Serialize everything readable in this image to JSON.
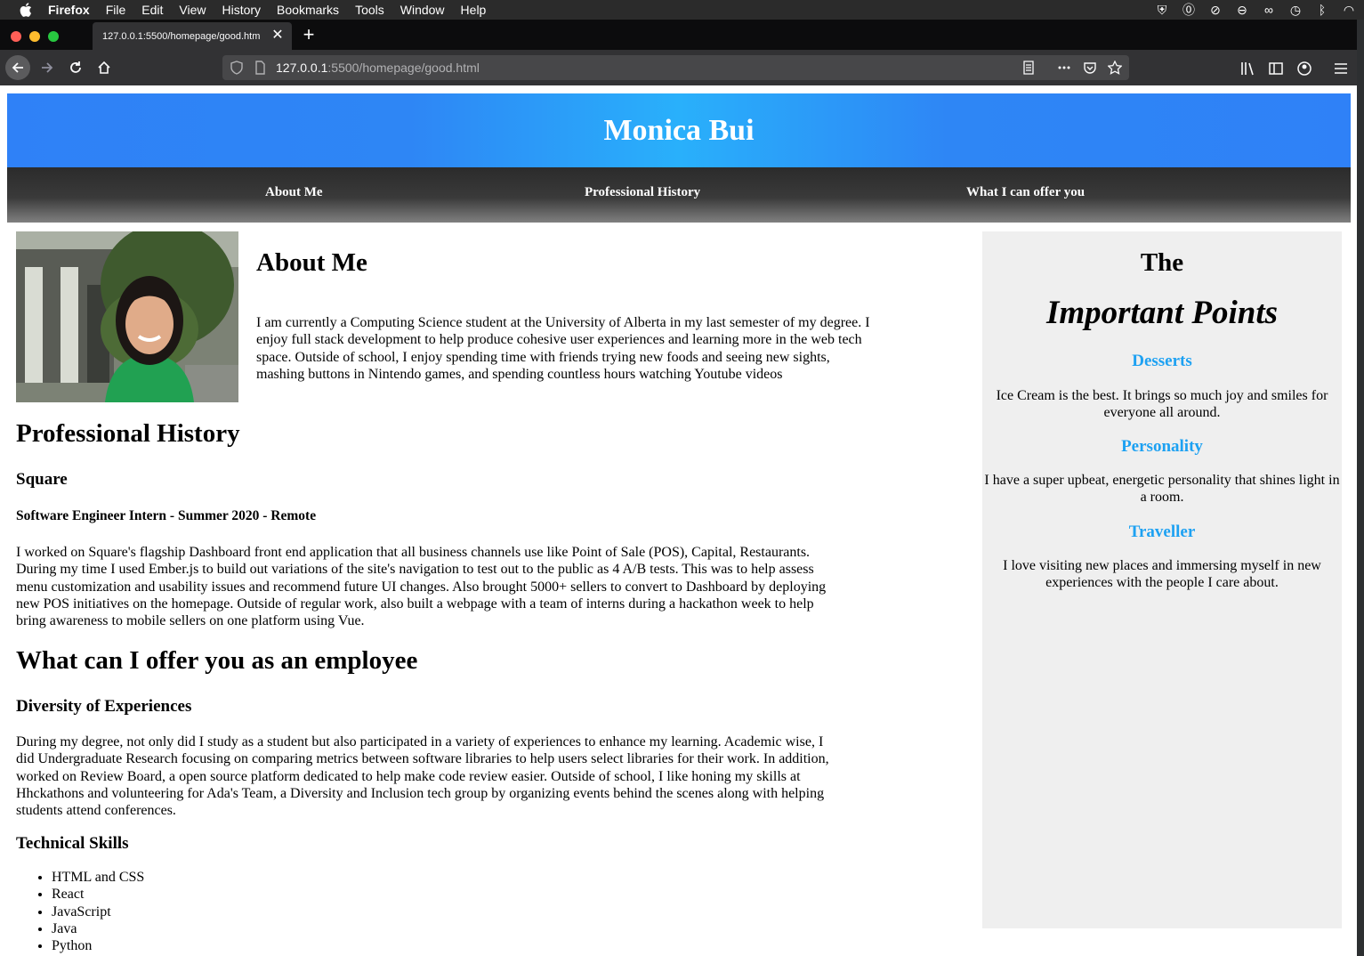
{
  "menubar": {
    "app": "Firefox",
    "items": [
      "File",
      "Edit",
      "View",
      "History",
      "Bookmarks",
      "Tools",
      "Window",
      "Help"
    ]
  },
  "browser": {
    "tab_title": "127.0.0.1:5500/homepage/good.htm",
    "url_host": "127.0.0.1",
    "url_rest": ":5500/homepage/good.html"
  },
  "site": {
    "name": "Monica Bui",
    "nav": [
      "About Me",
      "Professional History",
      "What I can offer you"
    ],
    "about": {
      "heading": "About Me",
      "text": "I am currently a Computing Science student at the University of Alberta in my last semester of my degree. I enjoy full stack development to help produce cohesive user experiences and learning more in the web tech space. Outside of school, I enjoy spending time with friends trying new foods and seeing new sights, mashing buttons in Nintendo games, and spending countless hours watching Youtube videos"
    },
    "history": {
      "heading": "Professional History",
      "company": "Square",
      "role": "Software Engineer Intern - Summer 2020 - Remote",
      "text": "I worked on Square's flagship Dashboard front end application that all business channels use like Point of Sale (POS), Capital, Restaurants. During my time I used Ember.js to build out variations of the site's navigation to test out to the public as 4 A/B tests. This was to help assess menu customization and usability issues and recommend future UI changes. Also brought 5000+ sellers to convert to Dashboard by deploying new POS initiatives on the homepage. Outside of regular work, also built a webpage with a team of interns during a hackathon week to help bring awareness to mobile sellers on one platform using Vue."
    },
    "offer": {
      "heading": "What can I offer you as an employee",
      "diversity_heading": "Diversity of Experiences",
      "diversity_text": "During my degree, not only did I study as a student but also participated in a variety of experiences to enhance my learning. Academic wise, I did Undergraduate Research focusing on comparing metrics between software libraries to help users select libraries for their work. In addition, worked on Review Board, a open source platform dedicated to help make code review easier. Outside of school, I like honing my skills at Hhckathons and volunteering for Ada's Team, a Diversity and Inclusion tech group by organizing events behind the scenes along with helping students attend conferences.",
      "skills_heading": "Technical Skills",
      "skills": [
        "HTML and CSS",
        "React",
        "JavaScript",
        "Java",
        "Python"
      ]
    },
    "aside": {
      "the": "The",
      "title": "Important Points",
      "points": [
        {
          "heading": "Desserts",
          "text": "Ice Cream is the best. It brings so much joy and smiles for everyone all around."
        },
        {
          "heading": "Personality",
          "text": "I have a super upbeat, energetic personality that shines light in a room."
        },
        {
          "heading": "Traveller",
          "text": "I love visiting new places and immersing myself in new experiences with the people I care about."
        }
      ]
    }
  },
  "colors": {
    "header_blue": "#2f81f7",
    "header_cyan": "#29b0fb",
    "point_heading": "#1da1f2",
    "aside_bg": "#efefef"
  }
}
